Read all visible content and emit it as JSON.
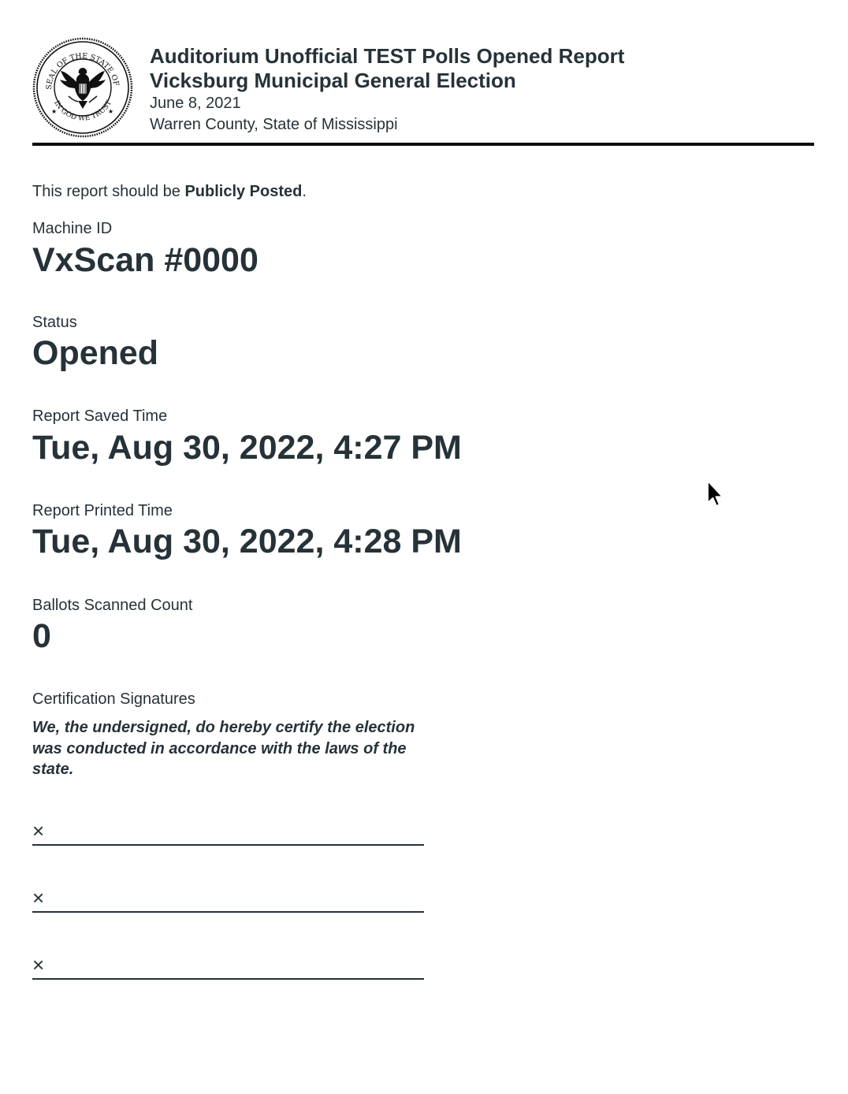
{
  "header": {
    "title": "Auditorium Unofficial TEST Polls Opened Report",
    "election_name": "Vicksburg Municipal General Election",
    "election_date": "June 8, 2021",
    "jurisdiction": "Warren County, State of Mississippi",
    "seal": {
      "icon": "state-seal-icon",
      "text_top": "THE GREAT SEAL OF THE STATE OF MISSISSIPPI",
      "text_bottom": "IN GOD WE TRUST"
    }
  },
  "notice": {
    "prefix": "This report should be ",
    "emphasis": "Publicly Posted",
    "suffix": "."
  },
  "fields": {
    "machine_id": {
      "label": "Machine ID",
      "value": "VxScan #0000"
    },
    "status": {
      "label": "Status",
      "value": "Opened"
    },
    "report_saved_time": {
      "label": "Report Saved Time",
      "value": "Tue, Aug 30, 2022, 4:27 PM"
    },
    "report_printed_time": {
      "label": "Report Printed Time",
      "value": "Tue, Aug 30, 2022, 4:28 PM"
    },
    "ballots_scanned_count": {
      "label": "Ballots Scanned Count",
      "value": "0"
    }
  },
  "certification": {
    "label": "Certification Signatures",
    "statement": "We, the undersigned, do hereby certify the election was conducted in accordance with the laws of the state.",
    "signature_lines": [
      {
        "mark": "×"
      },
      {
        "mark": "×"
      },
      {
        "mark": "×"
      }
    ]
  },
  "cursor": {
    "icon": "mouse-pointer-icon"
  },
  "colors": {
    "text": "#263238",
    "rule": "#0d0d0d",
    "background": "#ffffff"
  }
}
